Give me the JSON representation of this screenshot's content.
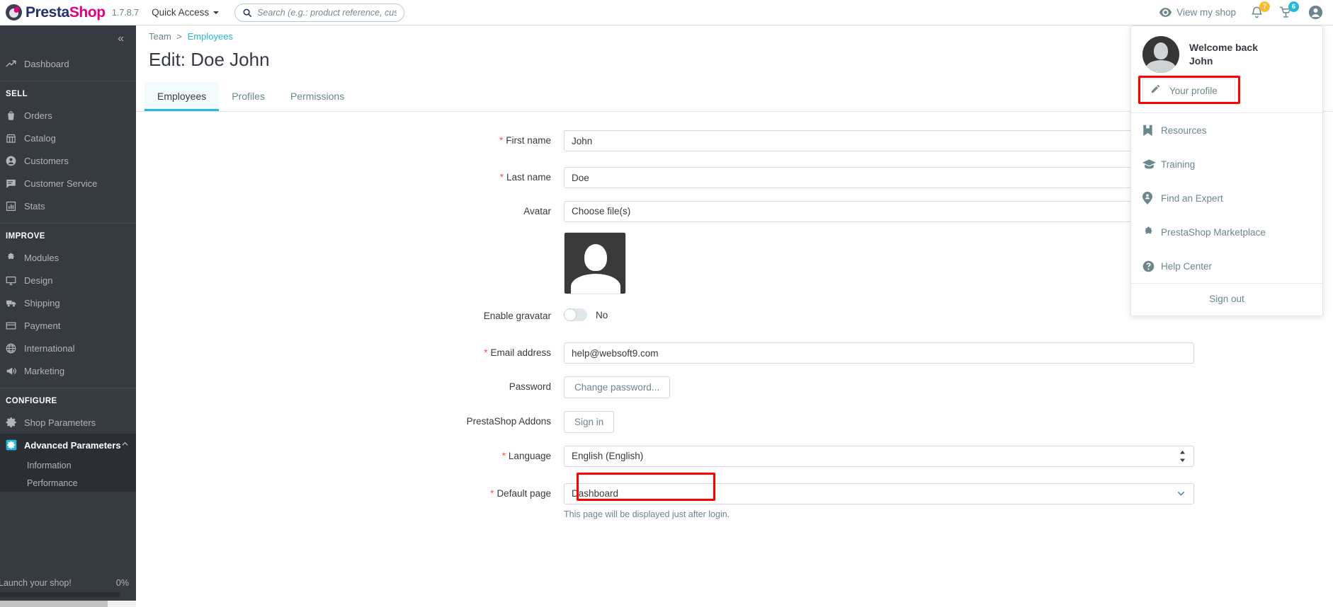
{
  "header": {
    "brand_prefix": "Presta",
    "brand_suffix": "Shop",
    "version": "1.7.8.7",
    "quick_access": "Quick Access",
    "search_placeholder": "Search (e.g.: product reference, custon",
    "search_value": "",
    "view_shop": "View my shop",
    "notifications_badge": "7",
    "cart_badge": "6",
    "accent_pink": "#e5007d",
    "accent_navy": "#22306f",
    "badge_warn_color": "#fbbc34",
    "badge_info_color": "#25b9d7"
  },
  "sidebar": {
    "collapse_label": "«",
    "dashboard": {
      "label": "Dashboard",
      "icon": "trending-up-icon"
    },
    "sections": [
      {
        "title": "SELL",
        "items": [
          {
            "label": "Orders",
            "icon": "shopping-basket-icon"
          },
          {
            "label": "Catalog",
            "icon": "store-icon"
          },
          {
            "label": "Customers",
            "icon": "person-circle-icon"
          },
          {
            "label": "Customer Service",
            "icon": "chat-icon"
          },
          {
            "label": "Stats",
            "icon": "bar-chart-icon"
          }
        ]
      },
      {
        "title": "IMPROVE",
        "items": [
          {
            "label": "Modules",
            "icon": "puzzle-icon"
          },
          {
            "label": "Design",
            "icon": "monitor-icon"
          },
          {
            "label": "Shipping",
            "icon": "truck-icon"
          },
          {
            "label": "Payment",
            "icon": "credit-card-icon"
          },
          {
            "label": "International",
            "icon": "globe-icon"
          },
          {
            "label": "Marketing",
            "icon": "megaphone-icon"
          }
        ]
      },
      {
        "title": "CONFIGURE",
        "items": [
          {
            "label": "Shop Parameters",
            "icon": "gear-icon"
          },
          {
            "label": "Advanced Parameters",
            "icon": "gear-active-icon",
            "active": true,
            "expanded": true
          }
        ]
      }
    ],
    "advanced_sub": [
      {
        "label": "Information"
      },
      {
        "label": "Performance"
      }
    ],
    "launch": {
      "label": "Launch your shop!",
      "percent": "0%"
    }
  },
  "main": {
    "breadcrumb": {
      "parent": "Team",
      "separator": ">",
      "current": "Employees"
    },
    "page_title": "Edit: Doe John",
    "tabs": [
      {
        "label": "Employees",
        "active": true
      },
      {
        "label": "Profiles",
        "active": false
      },
      {
        "label": "Permissions",
        "active": false
      }
    ],
    "form": {
      "first_name": {
        "label": "First name",
        "required": true,
        "value": "John"
      },
      "last_name": {
        "label": "Last name",
        "required": true,
        "value": "Doe"
      },
      "avatar": {
        "label": "Avatar",
        "required": false,
        "value": "Choose file(s)"
      },
      "enable_gravatar": {
        "label": "Enable gravatar",
        "required": false,
        "state": "No",
        "on": false
      },
      "email": {
        "label": "Email address",
        "required": true,
        "value": "help@websoft9.com"
      },
      "password": {
        "label": "Password",
        "required": false,
        "button": "Change password..."
      },
      "addons": {
        "label": "PrestaShop Addons",
        "required": false,
        "button": "Sign in"
      },
      "language": {
        "label": "Language",
        "required": true,
        "value": "English (English)",
        "highlighted": true
      },
      "default_page": {
        "label": "Default page",
        "required": true,
        "value": "Dashboard",
        "helper": "This page will be displayed just after login."
      }
    }
  },
  "profile_menu": {
    "welcome_line1": "Welcome back",
    "welcome_line2": "John",
    "your_profile": "Your profile",
    "items": [
      {
        "label": "Resources",
        "icon": "bookmark-icon"
      },
      {
        "label": "Training",
        "icon": "graduation-cap-icon"
      },
      {
        "label": "Find an Expert",
        "icon": "map-pin-person-icon"
      },
      {
        "label": "PrestaShop Marketplace",
        "icon": "puzzle-icon"
      },
      {
        "label": "Help Center",
        "icon": "question-circle-icon"
      }
    ],
    "sign_out": "Sign out",
    "highlight_color": "#ff0000"
  }
}
